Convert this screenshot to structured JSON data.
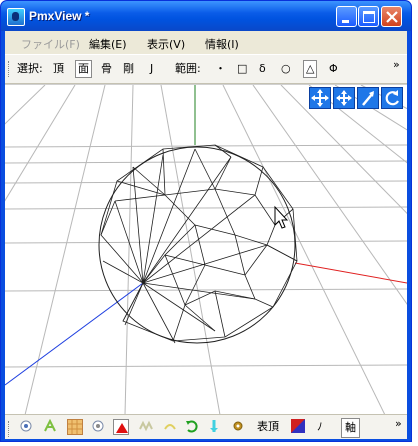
{
  "window": {
    "title": "PmxView *",
    "buttons": [
      "minimize",
      "maximize",
      "close"
    ]
  },
  "menubar": {
    "items": [
      {
        "label": "ファイル(F)",
        "disabled": true
      },
      {
        "label": "編集(E)",
        "disabled": false
      },
      {
        "label": "表示(V)",
        "disabled": false
      },
      {
        "label": "情報(I)",
        "disabled": false
      }
    ]
  },
  "toolbar": {
    "select_label": "選択:",
    "select_items": [
      "頂",
      "面",
      "骨",
      "剛",
      "J"
    ],
    "select_active": "面",
    "range_label": "範囲:",
    "range_items": [
      "・",
      "□",
      "δ",
      "○",
      "△",
      "Φ"
    ],
    "range_active": "△",
    "overflow": "»"
  },
  "viewport": {
    "nav_icons": [
      "rotate-move-icon",
      "pan-icon",
      "zoom-icon",
      "reset-view-icon"
    ],
    "axis_colors": {
      "x": "#e02020",
      "y": "#208020",
      "z": "#2040e0"
    },
    "grid_color": "#b8b8b8",
    "mesh_color": "#202020",
    "cursor": "arrow"
  },
  "statusbar": {
    "vertex_face_label": "表頂",
    "bone_label": "ﾉ",
    "axis_label": "軸",
    "overflow": "»",
    "icons": [
      "radio-icon",
      "leaf-icon",
      "texture-icon",
      "radio-icon",
      "triangle-red-icon",
      "wave-icon",
      "morph-icon",
      "green-arrow-icon",
      "cyan-arrow-icon",
      "gear-icon",
      "material-color-icon"
    ]
  }
}
